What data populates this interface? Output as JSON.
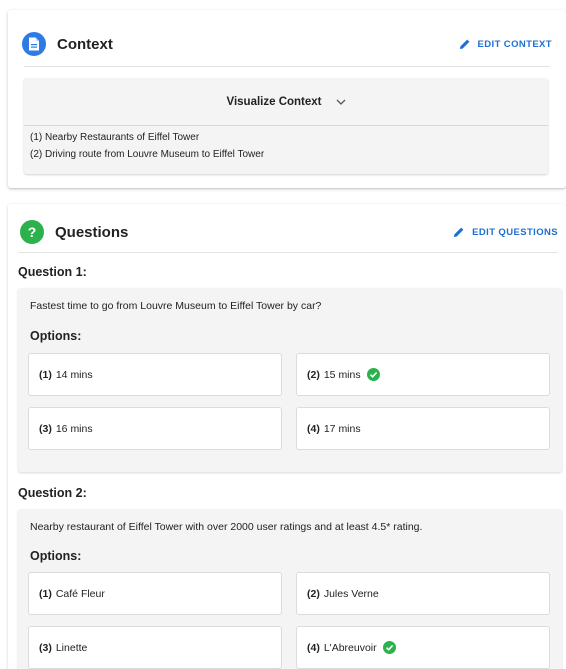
{
  "context": {
    "title": "Context",
    "edit_label": "EDIT CONTEXT",
    "visualize_label": "Visualize Context",
    "items": [
      "(1) Nearby Restaurants of Eiffel Tower",
      "(2) Driving route from Louvre Museum to Eiffel Tower"
    ]
  },
  "questions": {
    "title": "Questions",
    "edit_label": "EDIT QUESTIONS",
    "options_label": "Options:",
    "list": [
      {
        "label": "Question 1:",
        "text": "Fastest time to go from Louvre Museum to Eiffel Tower by car?",
        "options": [
          {
            "num": "(1)",
            "text": "14 mins",
            "correct": false
          },
          {
            "num": "(2)",
            "text": "15 mins",
            "correct": true
          },
          {
            "num": "(3)",
            "text": "16 mins",
            "correct": false
          },
          {
            "num": "(4)",
            "text": "17 mins",
            "correct": false
          }
        ]
      },
      {
        "label": "Question 2:",
        "text": "Nearby restaurant of Eiffel Tower with over 2000 user ratings and at least 4.5* rating.",
        "options": [
          {
            "num": "(1)",
            "text": "Café Fleur",
            "correct": false
          },
          {
            "num": "(2)",
            "text": "Jules Verne",
            "correct": false
          },
          {
            "num": "(3)",
            "text": "Linette",
            "correct": false
          },
          {
            "num": "(4)",
            "text": "L'Abreuvoir",
            "correct": true
          }
        ]
      }
    ]
  },
  "colors": {
    "context_icon": "#2f7be5",
    "questions_icon": "#2bb24c",
    "accent": "#1e6fd0",
    "check": "#2bb24c"
  },
  "icons": {
    "context": "document-icon",
    "questions": "question-mark-icon",
    "edit": "pencil-icon",
    "expand": "chevron-down-icon",
    "correct": "check-circle-icon"
  }
}
